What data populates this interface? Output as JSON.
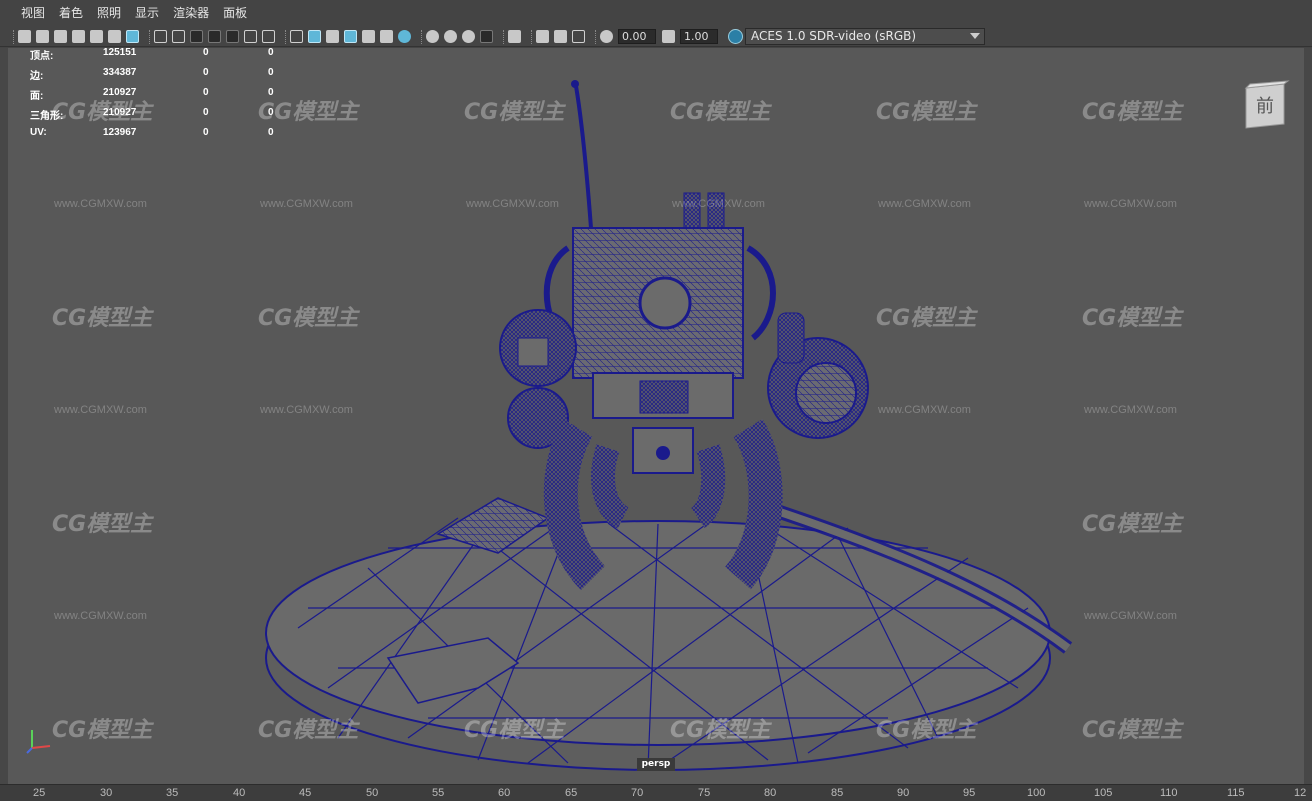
{
  "menu": [
    "视图",
    "着色",
    "照明",
    "显示",
    "渲染器",
    "面板"
  ],
  "toolbar": {
    "exposure_value": "0.00",
    "gamma_value": "1.00",
    "color_space": "ACES 1.0 SDR-video (sRGB)"
  },
  "hud": {
    "rows": [
      {
        "label": "顶点:",
        "value": "125151",
        "v2": "0",
        "v3": "0"
      },
      {
        "label": "边:",
        "value": "334387",
        "v2": "0",
        "v3": "0"
      },
      {
        "label": "面:",
        "value": "210927",
        "v2": "0",
        "v3": "0"
      },
      {
        "label": "三角形:",
        "value": "210927",
        "v2": "0",
        "v3": "0"
      },
      {
        "label": "UV:",
        "value": "123967",
        "v2": "0",
        "v3": "0"
      }
    ]
  },
  "viewcube": {
    "face_label": "前"
  },
  "camera_label": "persp",
  "watermark": {
    "logo": "CG模型主",
    "url": "www.CGMXW.com"
  },
  "ruler_ticks": [
    "25",
    "30",
    "35",
    "40",
    "45",
    "50",
    "55",
    "60",
    "65",
    "70",
    "75",
    "80",
    "85",
    "90",
    "95",
    "100",
    "105",
    "110",
    "115",
    "12"
  ],
  "colors": {
    "viewport_bg": "#585858",
    "wireframe": "#1a1a8c",
    "mesh_fill": "#6b6b6b",
    "accent": "#5fb7d8"
  }
}
